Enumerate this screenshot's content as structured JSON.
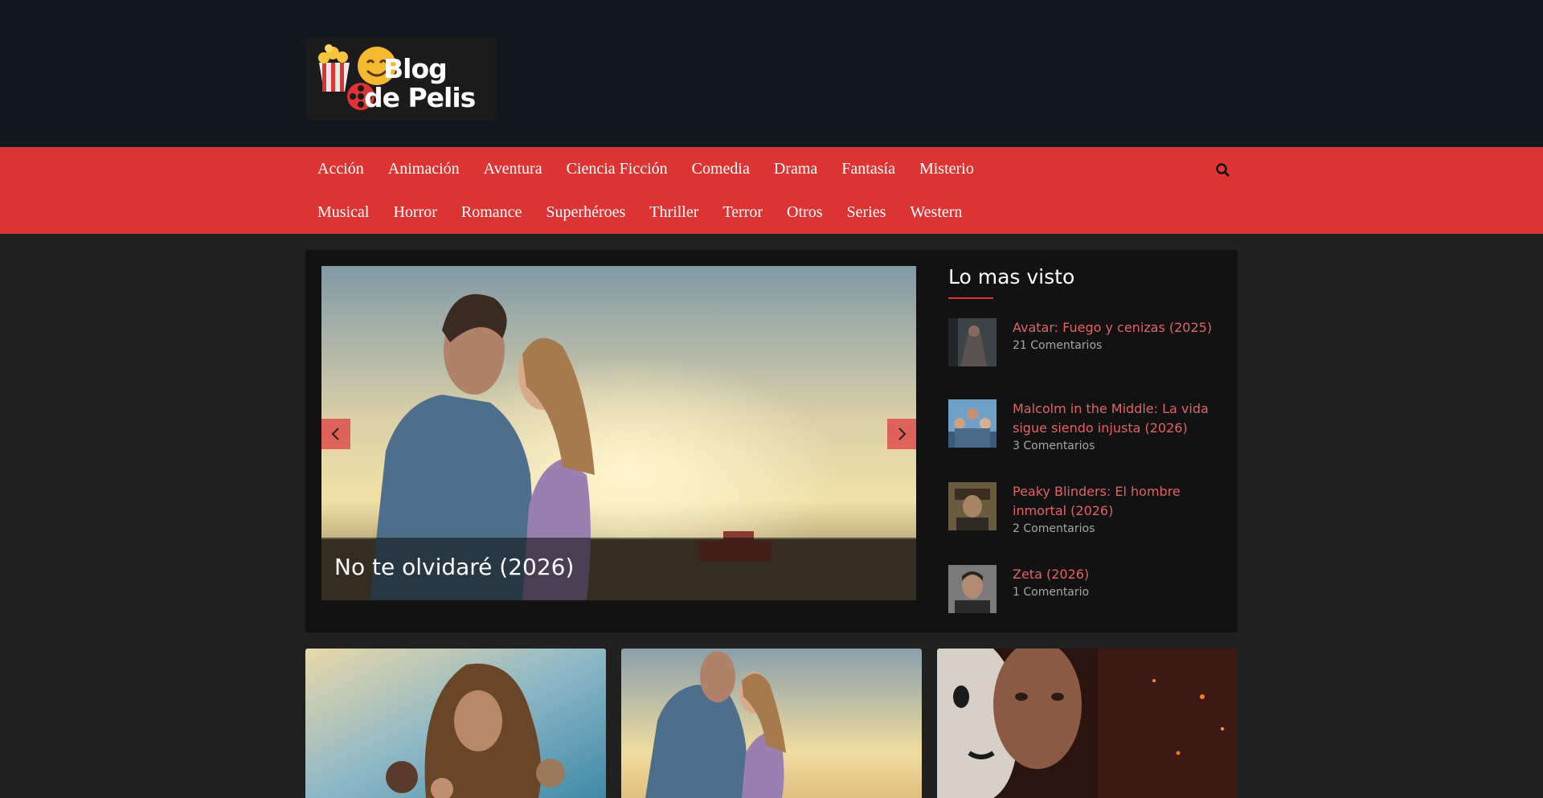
{
  "site": {
    "logo_line1": "Blog",
    "logo_line2": "de Pelis"
  },
  "nav": {
    "row1": [
      "Acción",
      "Animación",
      "Aventura",
      "Ciencia Ficción",
      "Comedia",
      "Drama",
      "Fantasía",
      "Misterio"
    ],
    "row2": [
      "Musical",
      "Horror",
      "Romance",
      "Superhéroes",
      "Thriller",
      "Terror",
      "Otros",
      "Series",
      "Western"
    ],
    "search_icon": "search-icon"
  },
  "slider": {
    "title": "No te olvidaré (2026)",
    "prev_icon": "chevron-left-icon",
    "next_icon": "chevron-right-icon"
  },
  "sidebar": {
    "title": "Lo mas visto",
    "items": [
      {
        "title": "Avatar: Fuego y cenizas (2025)",
        "meta": "21 Comentarios"
      },
      {
        "title": "Malcolm in the Middle: La vida sigue siendo injusta (2026)",
        "meta": "3 Comentarios"
      },
      {
        "title": "Peaky Blinders: El hombre inmortal (2026)",
        "meta": "2 Comentarios"
      },
      {
        "title": "Zeta (2026)",
        "meta": "1 Comentario"
      }
    ]
  },
  "colors": {
    "accent": "#dd3333",
    "link": "#e06464",
    "header_bg": "#111820",
    "page_bg": "#202020",
    "panel_bg": "#121212"
  }
}
